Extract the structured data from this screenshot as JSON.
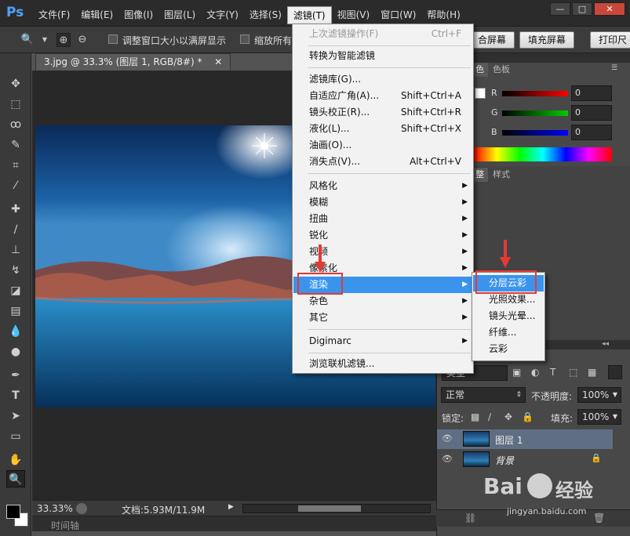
{
  "app": {
    "logo": "Ps",
    "menu": [
      "文件(F)",
      "编辑(E)",
      "图像(I)",
      "图层(L)",
      "文字(Y)",
      "选择(S)",
      "滤镜(T)",
      "视图(V)",
      "窗口(W)",
      "帮助(H)"
    ],
    "active_menu_index": 6,
    "win_controls": [
      "—",
      "□",
      "✕"
    ]
  },
  "options": {
    "fit_window_label": "调整窗口大小以满屏显示",
    "zoom_all_label": "缩放所有",
    "fit_screen_label": "合屏幕",
    "fill_screen_label": "填充屏幕",
    "print_size_label": "打印尺"
  },
  "document": {
    "tab_title": "3.jpg @ 33.3% (图层 1, RGB/8#) *",
    "tab_close": "✕",
    "zoom": "33.33%",
    "doc_info": "文档:5.93M/11.9M",
    "timeline_label": "时间轴"
  },
  "color_panel": {
    "tabs": [
      "色",
      "色板"
    ],
    "channels": [
      {
        "label": "R",
        "value": "0",
        "color": "#ff0000"
      },
      {
        "label": "G",
        "value": "0",
        "color": "#00cc00"
      },
      {
        "label": "B",
        "value": "0",
        "color": "#0000ff"
      }
    ]
  },
  "adjust_panel": {
    "tabs": [
      "整",
      "样式"
    ]
  },
  "layers_panel": {
    "blend_mode": "正常",
    "opacity_label": "不透明度:",
    "opacity_value": "100%",
    "lock_label": "锁定:",
    "fill_label": "填充:",
    "fill_value": "100%",
    "kind_label": "类型",
    "layers": [
      {
        "name": "图层 1",
        "selected": true,
        "locked": false
      },
      {
        "name": "背景",
        "selected": false,
        "locked": true
      }
    ]
  },
  "filter_menu": {
    "items": [
      {
        "label": "上次滤镜操作(F)",
        "shortcut": "Ctrl+F",
        "disabled": true
      },
      {
        "sep": true
      },
      {
        "label": "转换为智能滤镜",
        "shortcut": ""
      },
      {
        "sep": true
      },
      {
        "label": "滤镜库(G)...",
        "shortcut": ""
      },
      {
        "label": "自适应广角(A)...",
        "shortcut": "Shift+Ctrl+A"
      },
      {
        "label": "镜头校正(R)...",
        "shortcut": "Shift+Ctrl+R"
      },
      {
        "label": "液化(L)...",
        "shortcut": "Shift+Ctrl+X"
      },
      {
        "label": "油画(O)...",
        "shortcut": ""
      },
      {
        "label": "消失点(V)...",
        "shortcut": "Alt+Ctrl+V"
      },
      {
        "sep": true
      },
      {
        "label": "风格化",
        "submenu": true
      },
      {
        "label": "模糊",
        "submenu": true
      },
      {
        "label": "扭曲",
        "submenu": true
      },
      {
        "label": "锐化",
        "submenu": true
      },
      {
        "label": "视频",
        "submenu": true
      },
      {
        "label": "像素化",
        "submenu": true
      },
      {
        "label": "渲染",
        "submenu": true,
        "highlighted": true
      },
      {
        "label": "杂色",
        "submenu": true
      },
      {
        "label": "其它",
        "submenu": true
      },
      {
        "sep": true
      },
      {
        "label": "Digimarc",
        "submenu": true
      },
      {
        "sep": true
      },
      {
        "label": "浏览联机滤镜...",
        "shortcut": ""
      }
    ]
  },
  "render_submenu": {
    "items": [
      "分层云彩",
      "光照效果...",
      "镜头光晕...",
      "纤维...",
      "云彩"
    ],
    "highlighted_index": 0
  },
  "watermark": {
    "brand_left": "Bai",
    "brand_right": "经验",
    "url": "jingyan.baidu.com"
  }
}
